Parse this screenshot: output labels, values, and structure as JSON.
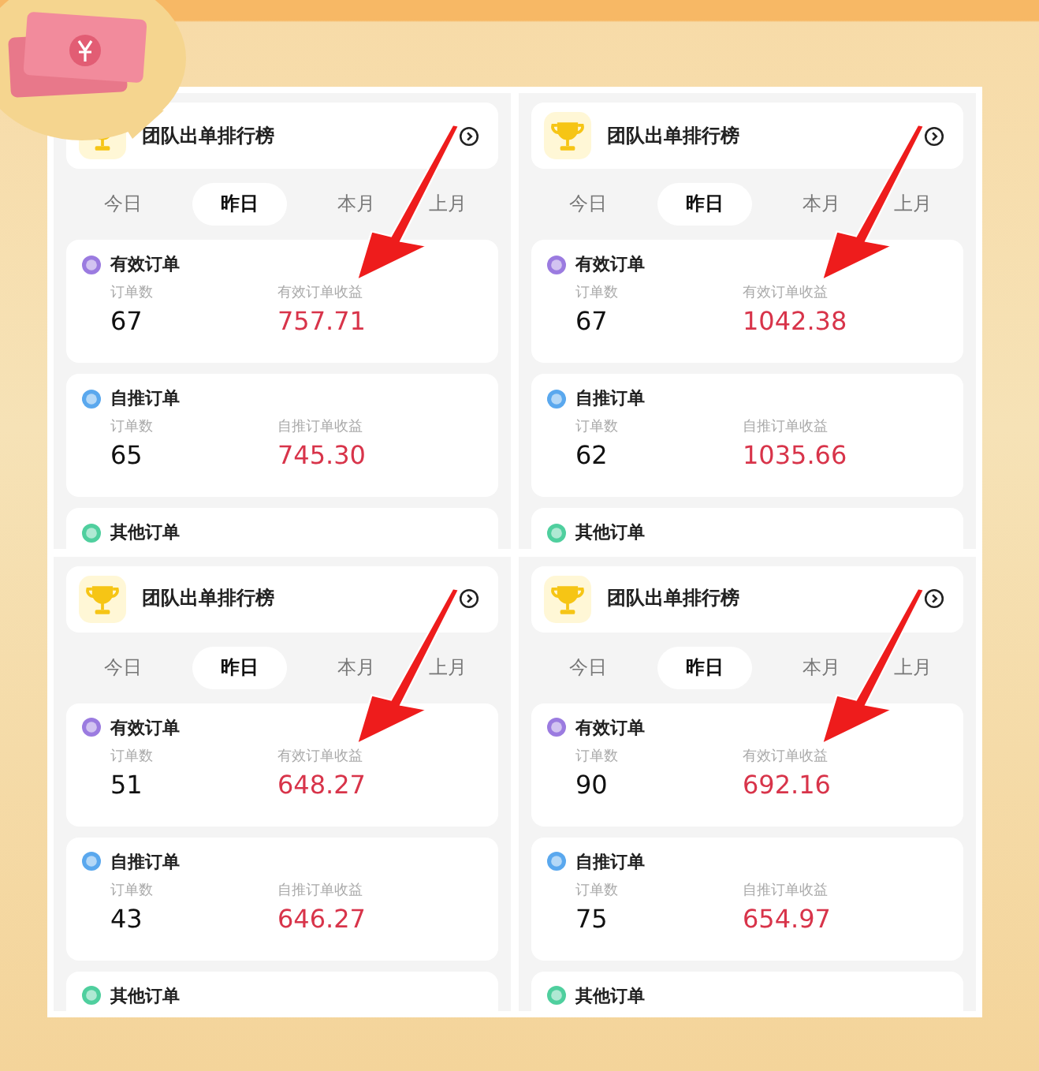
{
  "panels": [
    {
      "title": "团队出单排行榜",
      "tabs": [
        {
          "label": "今日",
          "selected": false
        },
        {
          "label": "昨日",
          "selected": true
        },
        {
          "label": "本月",
          "selected": false
        },
        {
          "label": "上月",
          "selected": false
        }
      ],
      "sections": [
        {
          "kind": "valid",
          "title": "有效订单",
          "count_label": "订单数",
          "count": "67",
          "income_label": "有效订单收益",
          "income": "757.71"
        },
        {
          "kind": "self",
          "title": "自推订单",
          "count_label": "订单数",
          "count": "65",
          "income_label": "自推订单收益",
          "income": "745.30"
        },
        {
          "kind": "other",
          "title": "其他订单"
        }
      ]
    },
    {
      "title": "团队出单排行榜",
      "tabs": [
        {
          "label": "今日",
          "selected": false
        },
        {
          "label": "昨日",
          "selected": true
        },
        {
          "label": "本月",
          "selected": false
        },
        {
          "label": "上月",
          "selected": false
        }
      ],
      "sections": [
        {
          "kind": "valid",
          "title": "有效订单",
          "count_label": "订单数",
          "count": "67",
          "income_label": "有效订单收益",
          "income": "1042.38"
        },
        {
          "kind": "self",
          "title": "自推订单",
          "count_label": "订单数",
          "count": "62",
          "income_label": "自推订单收益",
          "income": "1035.66"
        },
        {
          "kind": "other",
          "title": "其他订单"
        }
      ]
    },
    {
      "title": "团队出单排行榜",
      "tabs": [
        {
          "label": "今日",
          "selected": false
        },
        {
          "label": "昨日",
          "selected": true
        },
        {
          "label": "本月",
          "selected": false
        },
        {
          "label": "上月",
          "selected": false
        }
      ],
      "sections": [
        {
          "kind": "valid",
          "title": "有效订单",
          "count_label": "订单数",
          "count": "51",
          "income_label": "有效订单收益",
          "income": "648.27"
        },
        {
          "kind": "self",
          "title": "自推订单",
          "count_label": "订单数",
          "count": "43",
          "income_label": "自推订单收益",
          "income": "646.27"
        },
        {
          "kind": "other",
          "title": "其他订单"
        }
      ]
    },
    {
      "title": "团队出单排行榜",
      "tabs": [
        {
          "label": "今日",
          "selected": false
        },
        {
          "label": "昨日",
          "selected": true
        },
        {
          "label": "本月",
          "selected": false
        },
        {
          "label": "上月",
          "selected": false
        }
      ],
      "sections": [
        {
          "kind": "valid",
          "title": "有效订单",
          "count_label": "订单数",
          "count": "90",
          "income_label": "有效订单收益",
          "income": "692.16"
        },
        {
          "kind": "self",
          "title": "自推订单",
          "count_label": "订单数",
          "count": "75",
          "income_label": "自推订单收益",
          "income": "654.97"
        },
        {
          "kind": "other",
          "title": "其他订单"
        }
      ]
    }
  ]
}
